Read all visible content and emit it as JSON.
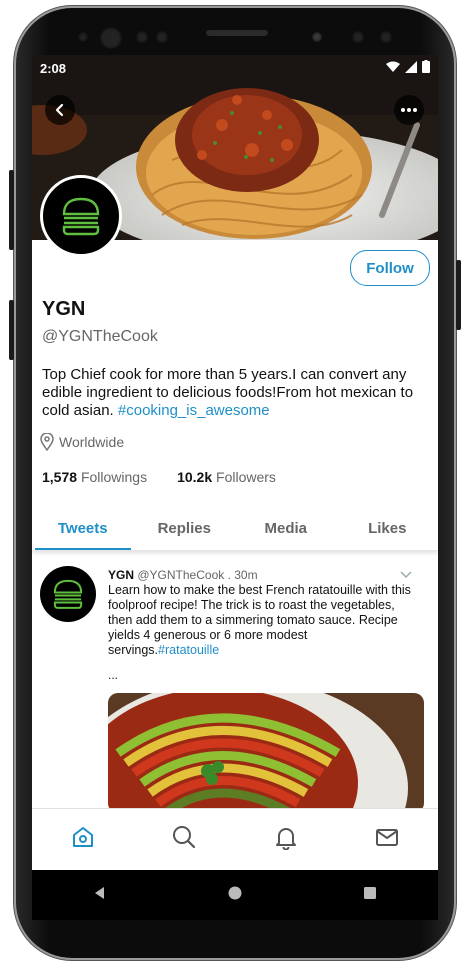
{
  "status_bar": {
    "time": "2:08"
  },
  "profile": {
    "name": "YGN",
    "handle": "@YGNTheCook",
    "bio_text": "Top Chief cook for more than 5 years.I can convert any edible ingredient to delicious foods!From hot mexican to cold asian. ",
    "bio_hashtag": "#cooking_is_awesome",
    "location": "Worldwide",
    "followings_count": "1,578",
    "followings_label": "Followings",
    "followers_count": "10.2k",
    "followers_label": "Followers",
    "follow_label": "Follow"
  },
  "tabs": [
    {
      "label": "Tweets",
      "active": true
    },
    {
      "label": "Replies",
      "active": false
    },
    {
      "label": "Media",
      "active": false
    },
    {
      "label": "Likes",
      "active": false
    }
  ],
  "tweet": {
    "author": "YGN",
    "handle": "@YGNTheCook",
    "time": ". 30m",
    "text": "Learn how to make the best French ratatouille with this foolproof recipe! The trick is to roast the vegetables, then add them to a simmering tomato sauce. Recipe yields 4 generous or 6 more modest servings.",
    "hashtag": "#ratatouille",
    "more": "..."
  },
  "icons": {
    "back": "back-arrow-icon",
    "more": "more-dots-icon",
    "location": "location-pin-icon",
    "home": "home-icon",
    "search": "search-icon",
    "notifications": "bell-icon",
    "messages": "mail-icon"
  },
  "colors": {
    "accent": "#1f8fc8",
    "logo_green": "#5fbf3f"
  }
}
